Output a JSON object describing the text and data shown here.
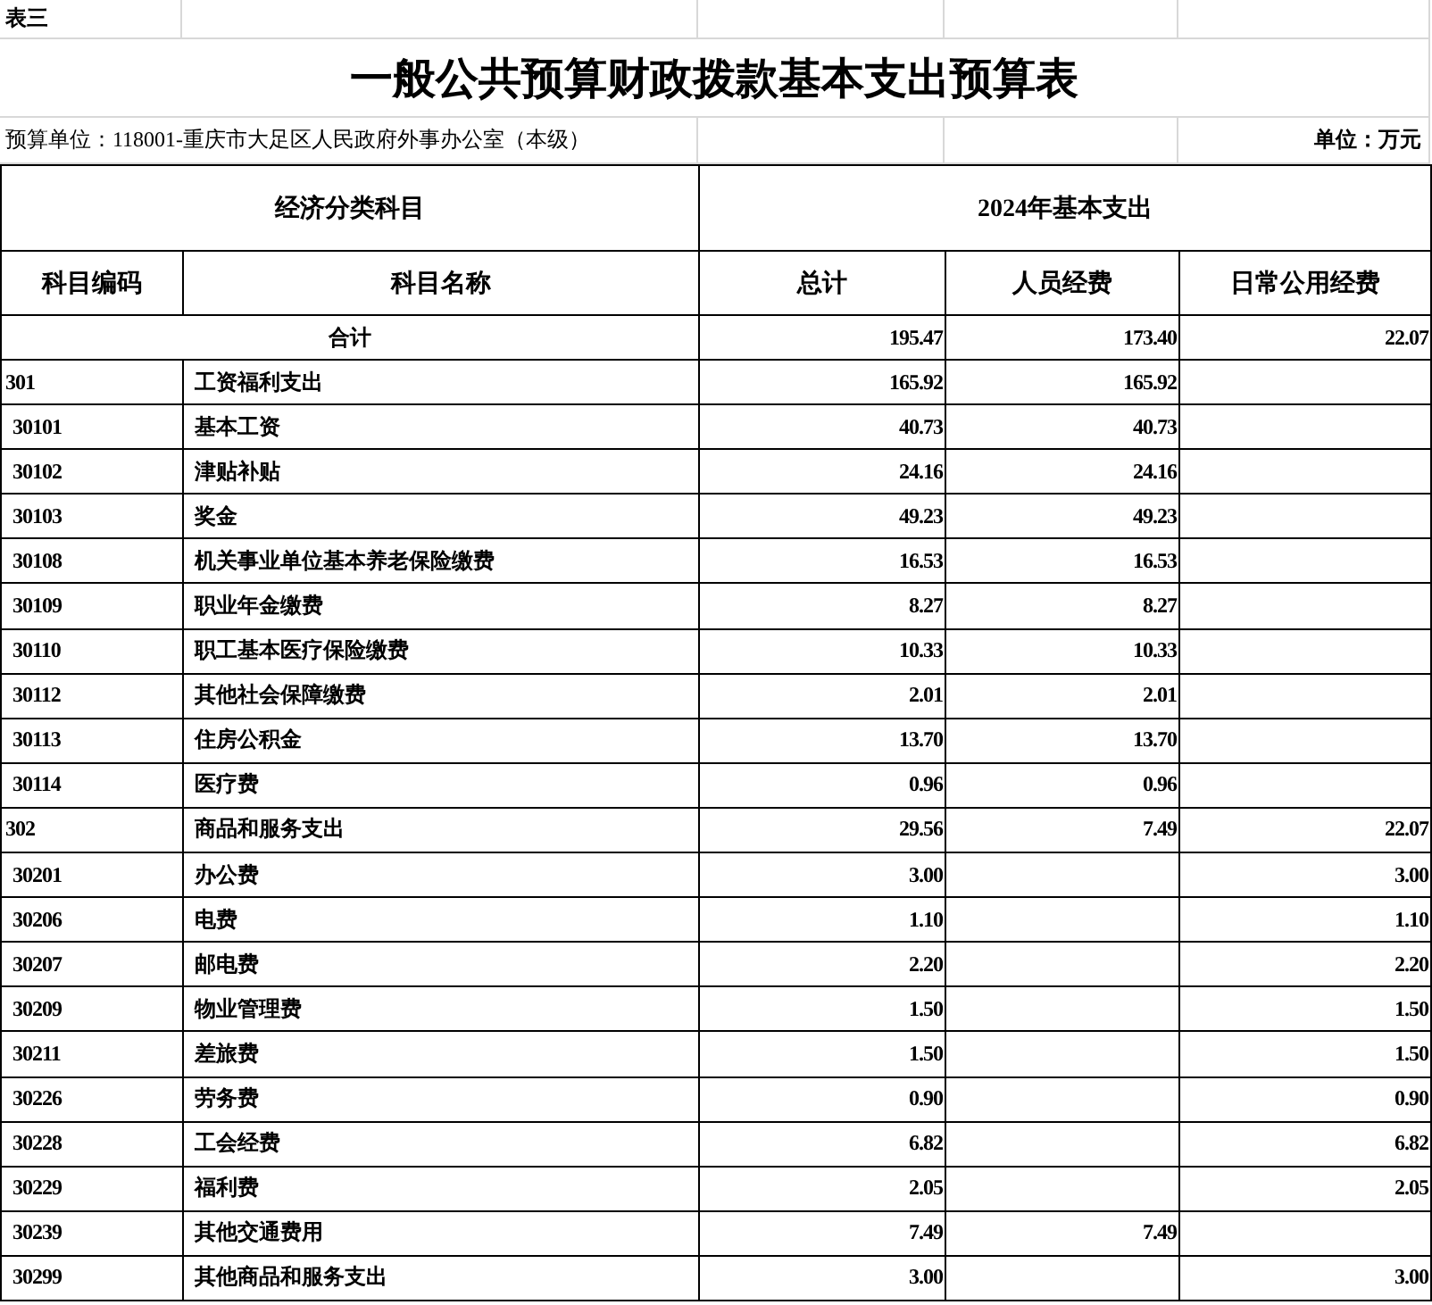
{
  "table_label": "表三",
  "title": "一般公共预算财政拨款基本支出预算表",
  "unit_info": "预算单位：118001-重庆市大足区人民政府外事办公室（本级）",
  "unit_label": "单位：万元",
  "group_headers": [
    "经济分类科目",
    "2024年基本支出"
  ],
  "columns": [
    "科目编码",
    "科目名称",
    "总计",
    "人员经费",
    "日常公用经费"
  ],
  "total_row": {
    "label": "合计",
    "total": "195.47",
    "personnel": "173.40",
    "public": "22.07"
  },
  "rows": [
    {
      "kind": "category",
      "code": "301",
      "name": "工资福利支出",
      "total": "165.92",
      "personnel": "165.92",
      "public": ""
    },
    {
      "kind": "item",
      "code": "30101",
      "name": "基本工资",
      "total": "40.73",
      "personnel": "40.73",
      "public": ""
    },
    {
      "kind": "item",
      "code": "30102",
      "name": "津贴补贴",
      "total": "24.16",
      "personnel": "24.16",
      "public": ""
    },
    {
      "kind": "item",
      "code": "30103",
      "name": "奖金",
      "total": "49.23",
      "personnel": "49.23",
      "public": ""
    },
    {
      "kind": "item",
      "code": "30108",
      "name": "机关事业单位基本养老保险缴费",
      "total": "16.53",
      "personnel": "16.53",
      "public": ""
    },
    {
      "kind": "item",
      "code": "30109",
      "name": "职业年金缴费",
      "total": "8.27",
      "personnel": "8.27",
      "public": ""
    },
    {
      "kind": "item",
      "code": "30110",
      "name": "职工基本医疗保险缴费",
      "total": "10.33",
      "personnel": "10.33",
      "public": ""
    },
    {
      "kind": "item",
      "code": "30112",
      "name": "其他社会保障缴费",
      "total": "2.01",
      "personnel": "2.01",
      "public": ""
    },
    {
      "kind": "item",
      "code": "30113",
      "name": "住房公积金",
      "total": "13.70",
      "personnel": "13.70",
      "public": ""
    },
    {
      "kind": "item",
      "code": "30114",
      "name": "医疗费",
      "total": "0.96",
      "personnel": "0.96",
      "public": ""
    },
    {
      "kind": "category",
      "code": "302",
      "name": "商品和服务支出",
      "total": "29.56",
      "personnel": "7.49",
      "public": "22.07"
    },
    {
      "kind": "item",
      "code": "30201",
      "name": "办公费",
      "total": "3.00",
      "personnel": "",
      "public": "3.00"
    },
    {
      "kind": "item",
      "code": "30206",
      "name": "电费",
      "total": "1.10",
      "personnel": "",
      "public": "1.10"
    },
    {
      "kind": "item",
      "code": "30207",
      "name": "邮电费",
      "total": "2.20",
      "personnel": "",
      "public": "2.20"
    },
    {
      "kind": "item",
      "code": "30209",
      "name": "物业管理费",
      "total": "1.50",
      "personnel": "",
      "public": "1.50"
    },
    {
      "kind": "item",
      "code": "30211",
      "name": "差旅费",
      "total": "1.50",
      "personnel": "",
      "public": "1.50"
    },
    {
      "kind": "item",
      "code": "30226",
      "name": "劳务费",
      "total": "0.90",
      "personnel": "",
      "public": "0.90"
    },
    {
      "kind": "item",
      "code": "30228",
      "name": "工会经费",
      "total": "6.82",
      "personnel": "",
      "public": "6.82"
    },
    {
      "kind": "item",
      "code": "30229",
      "name": "福利费",
      "total": "2.05",
      "personnel": "",
      "public": "2.05"
    },
    {
      "kind": "item",
      "code": "30239",
      "name": "其他交通费用",
      "total": "7.49",
      "personnel": "7.49",
      "public": ""
    },
    {
      "kind": "item",
      "code": "30299",
      "name": "其他商品和服务支出",
      "total": "3.00",
      "personnel": "",
      "public": "3.00"
    }
  ]
}
